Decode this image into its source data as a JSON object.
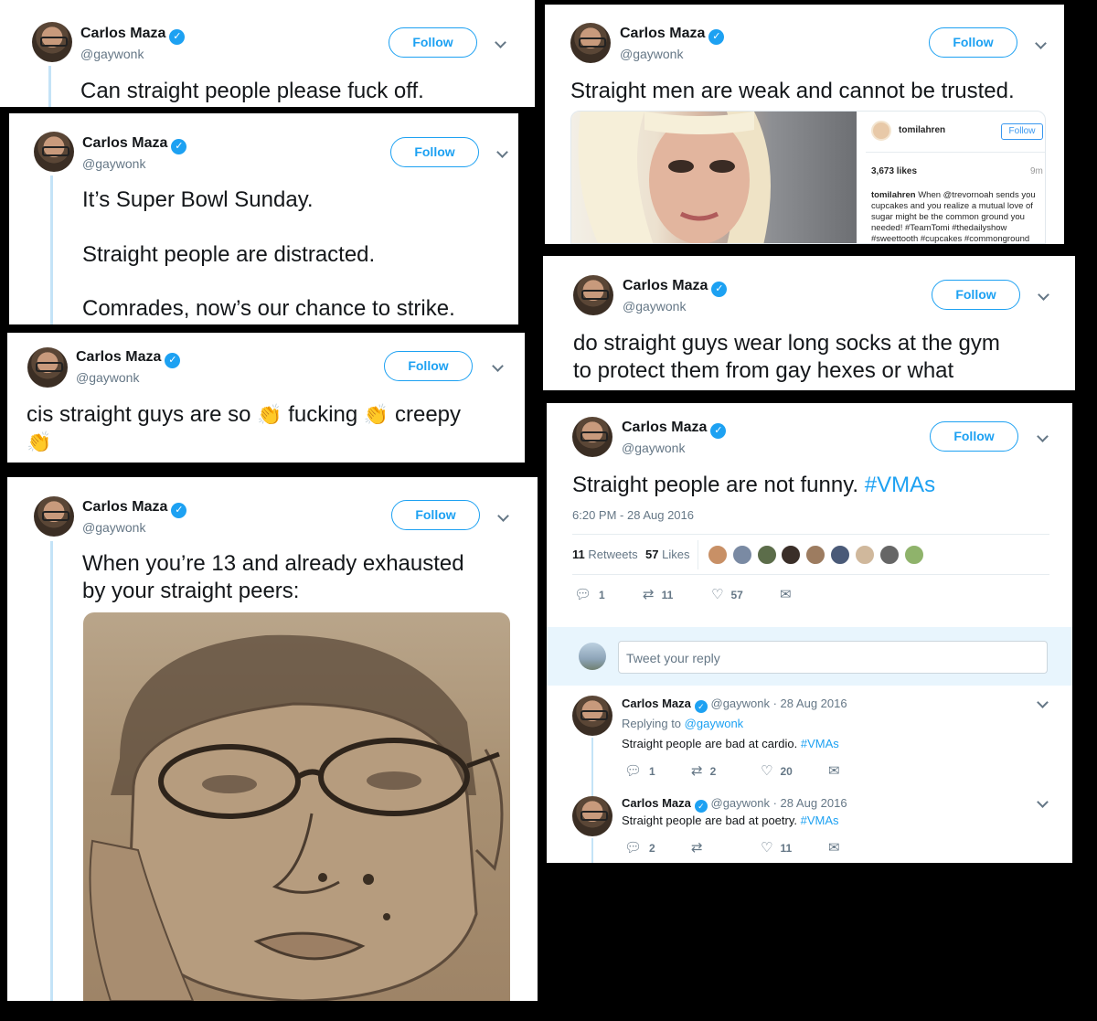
{
  "common": {
    "name": "Carlos Maza",
    "handle": "@gaywonk",
    "follow": "Follow",
    "verified_glyph": "✓"
  },
  "tweet1": {
    "text": "Can straight people please fuck off."
  },
  "tweet2": {
    "line1": "It’s Super Bowl Sunday.",
    "line2": "Straight people are distracted.",
    "line3": "Comrades, now’s our chance to strike."
  },
  "tweet3": {
    "part1": "cis straight guys are so",
    "part2": "fucking",
    "part3": "creepy",
    "emoji": "👏"
  },
  "tweet4": {
    "line1": "When you’re 13 and already exhausted",
    "line2": "by your straight peers:"
  },
  "tweet5": {
    "text": "Straight men are weak and cannot be trusted.",
    "embed": {
      "user": "tomilahren",
      "follow": "Follow",
      "likes": "3,673 likes",
      "age": "9m",
      "caption_user": "tomilahren",
      "caption": "When @trevornoah sends you cupcakes and you realize a mutual love of sugar might be the common ground you needed! #TeamTomi #thedailyshow #sweettooth #cupcakes #commonground"
    }
  },
  "tweet6": {
    "line1": "do straight guys wear long socks at the gym",
    "line2": "to protect them from gay hexes or what"
  },
  "tweet7": {
    "text": "Straight people are not funny. ",
    "hashtag": "#VMAs",
    "timestamp": "6:20 PM - 28 Aug 2016",
    "retweets_count": "11",
    "retweets_label": "Retweets",
    "likes_count": "57",
    "likes_label": "Likes",
    "reply_count": "1",
    "retweet_count": "11",
    "like_count": "57",
    "reply_placeholder": "Tweet your reply",
    "replies": [
      {
        "meta": "@gaywonk · 28 Aug 2016",
        "replying_prefix": "Replying to",
        "replying_to": "@gaywonk",
        "text": "Straight people are bad at cardio. ",
        "hashtag": "#VMAs",
        "replies": "1",
        "retweets": "2",
        "likes": "20"
      },
      {
        "meta": "@gaywonk · 28 Aug 2016",
        "text": "Straight people are bad at poetry. ",
        "hashtag": "#VMAs",
        "replies": "2",
        "retweets": "",
        "likes": "11"
      }
    ]
  },
  "colors": {
    "accent": "#1da1f2",
    "text": "#14171a",
    "muted": "#657786",
    "thread": "#c4e3f7"
  },
  "icons": [
    "verified-badge-icon",
    "chevron-down-icon",
    "reply-icon",
    "retweet-icon",
    "heart-icon",
    "message-icon",
    "clapping-hands-emoji"
  ]
}
